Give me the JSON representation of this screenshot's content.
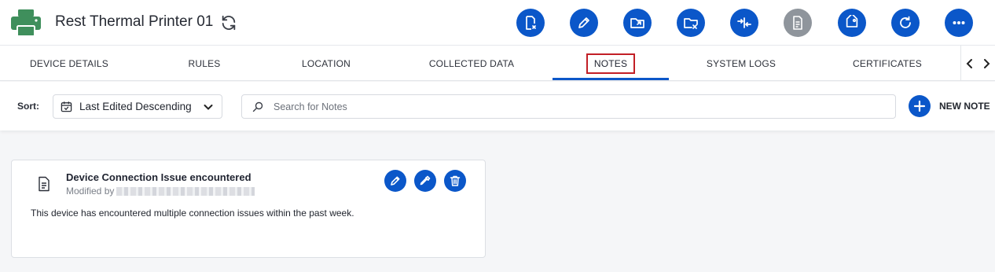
{
  "header": {
    "title": "Rest Thermal Printer 01",
    "toolbar_buttons": [
      {
        "name": "decommission-device-button",
        "icon": "device-x-icon"
      },
      {
        "name": "edit-device-button",
        "icon": "pencil-icon"
      },
      {
        "name": "move-to-folder-button",
        "icon": "folder-export-icon"
      },
      {
        "name": "remove-from-folder-button",
        "icon": "folder-x-icon"
      },
      {
        "name": "compare-button",
        "icon": "arrows-inward-icon"
      },
      {
        "name": "report-button",
        "icon": "document-icon",
        "disabled": true
      },
      {
        "name": "tag-button",
        "icon": "tag-icon"
      },
      {
        "name": "reboot-button",
        "icon": "restart-icon"
      },
      {
        "name": "more-actions-button",
        "icon": "ellipsis-icon"
      }
    ]
  },
  "tabs": [
    {
      "label": "DEVICE DETAILS"
    },
    {
      "label": "RULES"
    },
    {
      "label": "LOCATION"
    },
    {
      "label": "COLLECTED DATA"
    },
    {
      "label": "NOTES",
      "active": true
    },
    {
      "label": "SYSTEM LOGS"
    },
    {
      "label": "CERTIFICATES"
    }
  ],
  "toolbar": {
    "sort_label": "Sort:",
    "sort_value": "Last Edited Descending",
    "search_placeholder": "Search for Notes",
    "new_note_label": "NEW NOTE"
  },
  "note": {
    "title": "Device Connection Issue encountered",
    "modified_by_label": "Modified by",
    "body": "This device has encountered multiple connection issues within the past week."
  },
  "colors": {
    "accent": "#0b57c9",
    "highlight_border": "#c21f26",
    "printer_icon": "#3f8f5c",
    "disabled": "#8f959c"
  }
}
